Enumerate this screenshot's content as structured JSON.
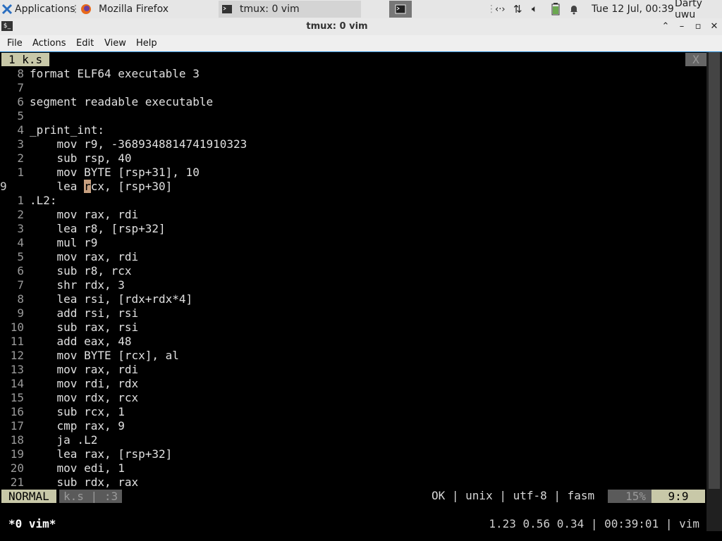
{
  "panel": {
    "apps_label": "Applications",
    "tasks": [
      "Mozilla Firefox",
      "tmux: 0 vim"
    ],
    "clock": "Tue 12 Jul, 00:39",
    "user": "Darty uwu"
  },
  "window": {
    "title": "tmux: 0 vim",
    "menu": [
      "File",
      "Actions",
      "Edit",
      "View",
      "Help"
    ]
  },
  "vim": {
    "tab_label": "1 k.s",
    "tab_close": "X",
    "lines": [
      {
        "n": "8",
        "text": "format ELF64 executable 3"
      },
      {
        "n": "7",
        "text": ""
      },
      {
        "n": "6",
        "text": "segment readable executable"
      },
      {
        "n": "5",
        "text": ""
      },
      {
        "n": "4",
        "text": "_print_int:"
      },
      {
        "n": "3",
        "text": "    mov r9, -3689348814741910323"
      },
      {
        "n": "2",
        "text": "    sub rsp, 40"
      },
      {
        "n": "1",
        "text": "    mov BYTE [rsp+31], 10"
      },
      {
        "n": "9",
        "text": "    lea rcx, [rsp+30]",
        "current": true
      },
      {
        "n": "1",
        "text": ".L2:"
      },
      {
        "n": "2",
        "text": "    mov rax, rdi"
      },
      {
        "n": "3",
        "text": "    lea r8, [rsp+32]"
      },
      {
        "n": "4",
        "text": "    mul r9"
      },
      {
        "n": "5",
        "text": "    mov rax, rdi"
      },
      {
        "n": "6",
        "text": "    sub r8, rcx"
      },
      {
        "n": "7",
        "text": "    shr rdx, 3"
      },
      {
        "n": "8",
        "text": "    lea rsi, [rdx+rdx*4]"
      },
      {
        "n": "9",
        "text": "    add rsi, rsi"
      },
      {
        "n": "10",
        "text": "    sub rax, rsi"
      },
      {
        "n": "11",
        "text": "    add eax, 48"
      },
      {
        "n": "12",
        "text": "    mov BYTE [rcx], al"
      },
      {
        "n": "13",
        "text": "    mov rax, rdi"
      },
      {
        "n": "14",
        "text": "    mov rdi, rdx"
      },
      {
        "n": "15",
        "text": "    mov rdx, rcx"
      },
      {
        "n": "16",
        "text": "    sub rcx, 1"
      },
      {
        "n": "17",
        "text": "    cmp rax, 9"
      },
      {
        "n": "18",
        "text": "    ja .L2"
      },
      {
        "n": "19",
        "text": "    lea rax, [rsp+32]"
      },
      {
        "n": "20",
        "text": "    mov edi, 1"
      },
      {
        "n": "21",
        "text": "    sub rdx, rax"
      }
    ],
    "status": {
      "mode": "NORMAL",
      "file": "k.s",
      "file_line": ":3",
      "right": "OK | unix | utf-8 | fasm",
      "percent": "15%",
      "position": "9:9"
    }
  },
  "tmux": {
    "window": "*0 vim*",
    "right": "1.23 0.56 0.34 | 00:39:01 | vim"
  },
  "colors": {
    "accent": "#c8c8a8",
    "menu_border": "#2e8fd6"
  }
}
